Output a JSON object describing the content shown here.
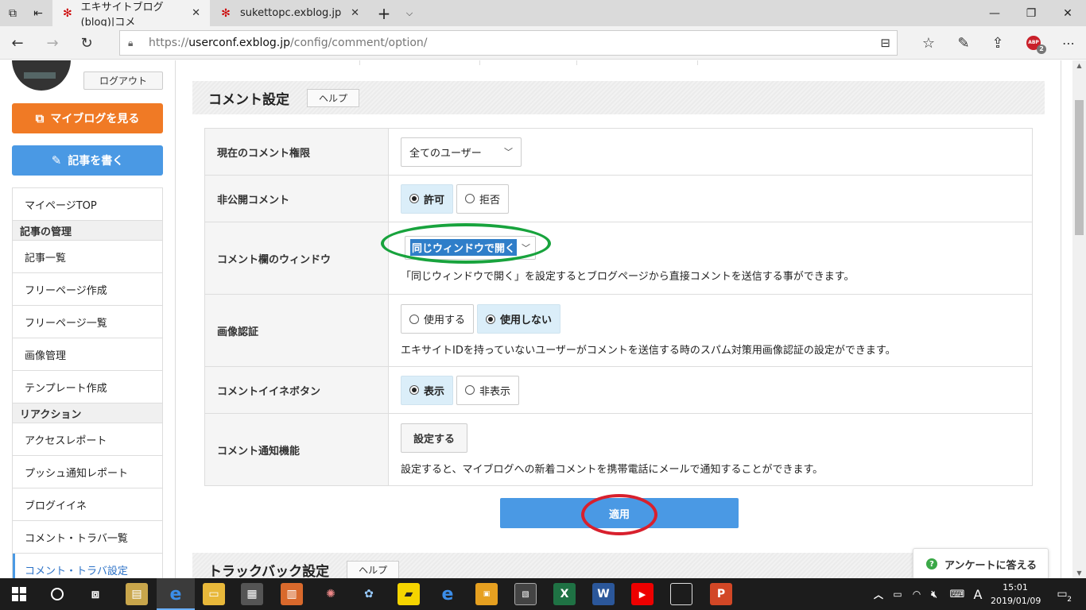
{
  "browser": {
    "tabs": [
      {
        "title": "エキサイトブログ (blog)|コメ",
        "active": true
      },
      {
        "title": "sukettopc.exblog.jp",
        "active": false
      }
    ],
    "url_prefix": "https://",
    "url_host": "userconf.exblog.jp",
    "url_path": "/config/comment/option/",
    "adblock_count": "2"
  },
  "sidebar": {
    "logout_label": "ログアウト",
    "myblog_label": "マイブログを見る",
    "write_label": "記事を書く",
    "menu": [
      {
        "type": "item",
        "label": "マイページTOP"
      },
      {
        "type": "head",
        "label": "記事の管理"
      },
      {
        "type": "item",
        "label": "記事一覧"
      },
      {
        "type": "item",
        "label": "フリーページ作成"
      },
      {
        "type": "item",
        "label": "フリーページ一覧"
      },
      {
        "type": "item",
        "label": "画像管理"
      },
      {
        "type": "item",
        "label": "テンプレート作成"
      },
      {
        "type": "head",
        "label": "リアクション"
      },
      {
        "type": "item",
        "label": "アクセスレポート"
      },
      {
        "type": "item",
        "label": "プッシュ通知レポート"
      },
      {
        "type": "item",
        "label": "ブログイイネ"
      },
      {
        "type": "item",
        "label": "コメント・トラバ一覧"
      },
      {
        "type": "item",
        "label": "コメント・トラバ設定",
        "current": true
      }
    ]
  },
  "comment_section": {
    "title": "コメント設定",
    "help_label": "ヘルプ",
    "rows": {
      "permission": {
        "label": "現在のコメント権限",
        "value": "全てのユーザー"
      },
      "private": {
        "label": "非公開コメント",
        "options": [
          "許可",
          "拒否"
        ],
        "selected": "許可"
      },
      "window": {
        "label": "コメント欄のウィンドウ",
        "value": "同じウィンドウで開く",
        "hint": "「同じウィンドウで開く」を設定するとブログページから直接コメントを送信する事ができます。"
      },
      "captcha": {
        "label": "画像認証",
        "options": [
          "使用する",
          "使用しない"
        ],
        "selected": "使用しない",
        "hint": "エキサイトIDを持っていないユーザーがコメントを送信する時のスパム対策用画像認証の設定ができます。"
      },
      "like": {
        "label": "コメントイイネボタン",
        "options": [
          "表示",
          "非表示"
        ],
        "selected": "表示"
      },
      "notify": {
        "label": "コメント通知機能",
        "button": "設定する",
        "hint": "設定すると、マイブログへの新着コメントを携帯電話にメールで通知することができます。"
      }
    },
    "apply_label": "適用"
  },
  "trackback_section": {
    "title": "トラックバック設定",
    "help_label": "ヘルプ"
  },
  "survey_label": "アンケートに答える",
  "taskbar": {
    "time": "15:01",
    "date": "2019/01/09",
    "ime": "A",
    "notifications": "2"
  },
  "colors": {
    "orange_button": "#f07a25",
    "blue_button": "#4a99e4",
    "annotation_green": "#18a33d",
    "annotation_red": "#d8202d"
  }
}
